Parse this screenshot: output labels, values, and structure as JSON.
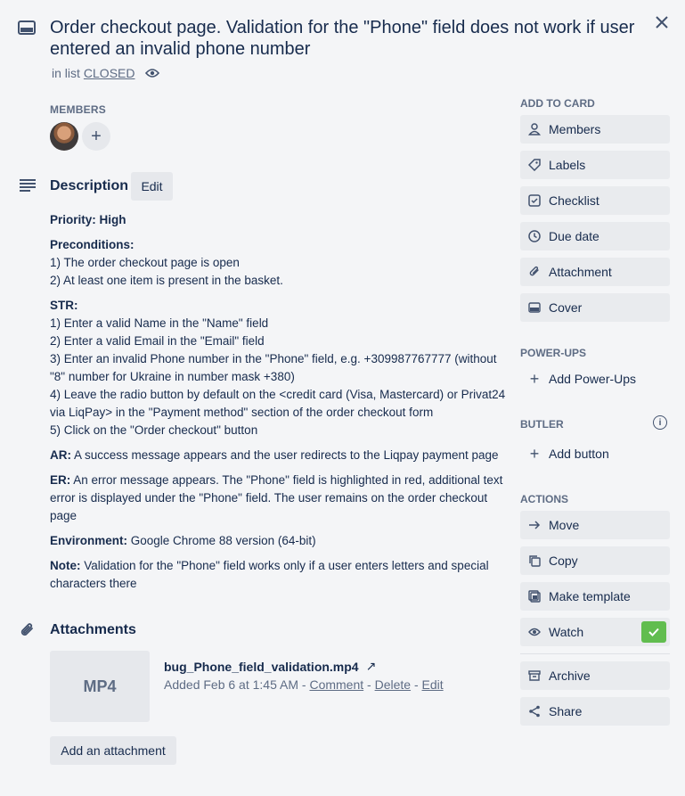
{
  "card": {
    "title": "Order checkout page. Validation for the \"Phone\" field does not work if user entered an invalid phone number",
    "in_list_prefix": "in list",
    "list_name": "CLOSED"
  },
  "members": {
    "label": "MEMBERS",
    "add_symbol": "+"
  },
  "description": {
    "title": "Description",
    "edit_label": "Edit",
    "priority_label": "Priority: High",
    "preconditions_label": "Preconditions:",
    "preconditions": [
      "1) The order checkout page is open",
      "2) At least one item is present in the basket."
    ],
    "str_label": "STR:",
    "steps": [
      "1) Enter a valid Name in the \"Name\" field",
      "2) Enter a valid Email in the \"Email\" field",
      "3) Enter an invalid Phone number in the \"Phone\" field, e.g. +309987767777 (without \"8\" number for Ukraine in number mask +380)",
      "4) Leave the radio button by default on the <credit card (Visa, Mastercard) or Privat24 via LiqPay> in the \"Payment method\" section of the order checkout form",
      "5) Click on the \"Order checkout\" button"
    ],
    "ar_label": "AR:",
    "ar_text": " A success message appears and the user redirects to the Liqpay payment page",
    "er_label": "ER:",
    "er_text": " An error message appears. The \"Phone\" field is highlighted in red, additional text error is displayed under the \"Phone\" field. The user remains on the order checkout page",
    "env_label": "Environment:",
    "env_text": " Google Chrome 88 version (64-bit)",
    "note_label": "Note:",
    "note_text": " Validation for the \"Phone\" field works only if a user enters letters and special characters there"
  },
  "attachments": {
    "title": "Attachments",
    "thumb_label": "MP4",
    "file_name": "bug_Phone_field_validation.mp4",
    "open_symbol": "↗",
    "added": "Added Feb 6 at 1:45 AM",
    "sep": " - ",
    "comment": "Comment",
    "delete": "Delete",
    "edit": "Edit",
    "add_label": "Add an attachment"
  },
  "sidebar": {
    "add_to_card_label": "ADD TO CARD",
    "members": "Members",
    "labels": "Labels",
    "checklist": "Checklist",
    "due_date": "Due date",
    "attachment": "Attachment",
    "cover": "Cover",
    "powerups_label": "POWER-UPS",
    "add_powerups": "Add Power-Ups",
    "butler_label": "BUTLER",
    "butler_info": "i",
    "add_button": "Add button",
    "actions_label": "ACTIONS",
    "move": "Move",
    "copy": "Copy",
    "make_template": "Make template",
    "watch": "Watch",
    "archive": "Archive",
    "share": "Share",
    "plus": "+"
  },
  "colors": {
    "background": "#f4f5f7",
    "text": "#172b4d",
    "muted": "#5e6c84",
    "button": "#e9ebee",
    "watch_check": "#61bd4f"
  }
}
